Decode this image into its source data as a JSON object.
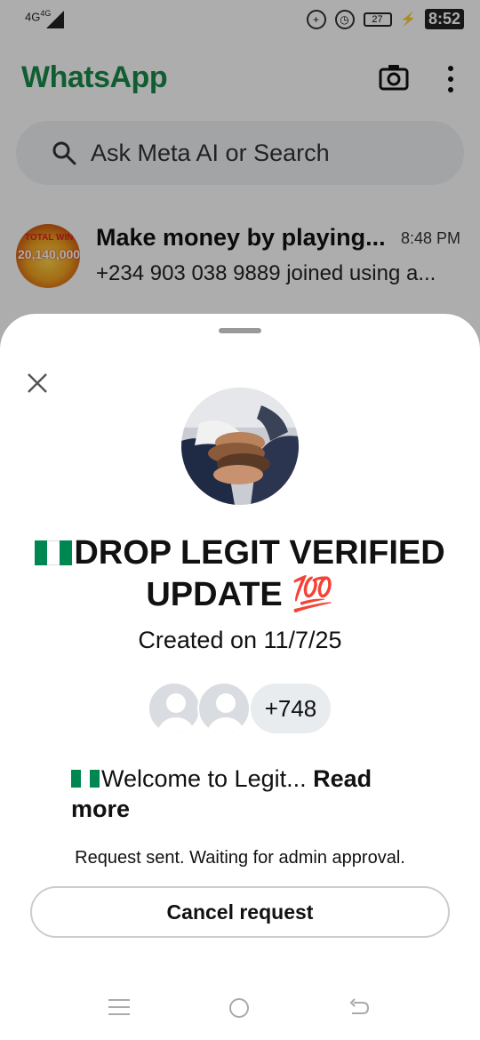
{
  "status_bar": {
    "network": "4G",
    "network2": "4G",
    "battery_level": "27",
    "time": "8:52"
  },
  "header": {
    "app_title": "WhatsApp",
    "camera_icon": "camera-icon",
    "menu_icon": "more-vert-icon"
  },
  "search": {
    "placeholder": "Ask Meta AI or Search",
    "icon": "search-icon"
  },
  "chat_list": [
    {
      "name": "Make money by playing...",
      "time": "8:48 PM",
      "preview": "+234 903 038 9889 joined using a...",
      "avatar_text_1": "TOTAL WIN",
      "avatar_text_2": "20,140,000"
    }
  ],
  "sheet": {
    "close_icon": "close-icon",
    "group_name_main": "DROP LEGIT VERIFIED UPDATE",
    "group_name_emoji": "💯",
    "created": "Created on 11/7/25",
    "member_count": "+748",
    "description": "Welcome to Legit...",
    "read_more": "Read more",
    "request_status": "Request sent. Waiting for admin approval.",
    "cancel_label": "Cancel request"
  },
  "colors": {
    "brand_green": "#1a8a4a",
    "flag_green": "#008751",
    "scrim": "rgba(0,0,0,0.32)"
  }
}
